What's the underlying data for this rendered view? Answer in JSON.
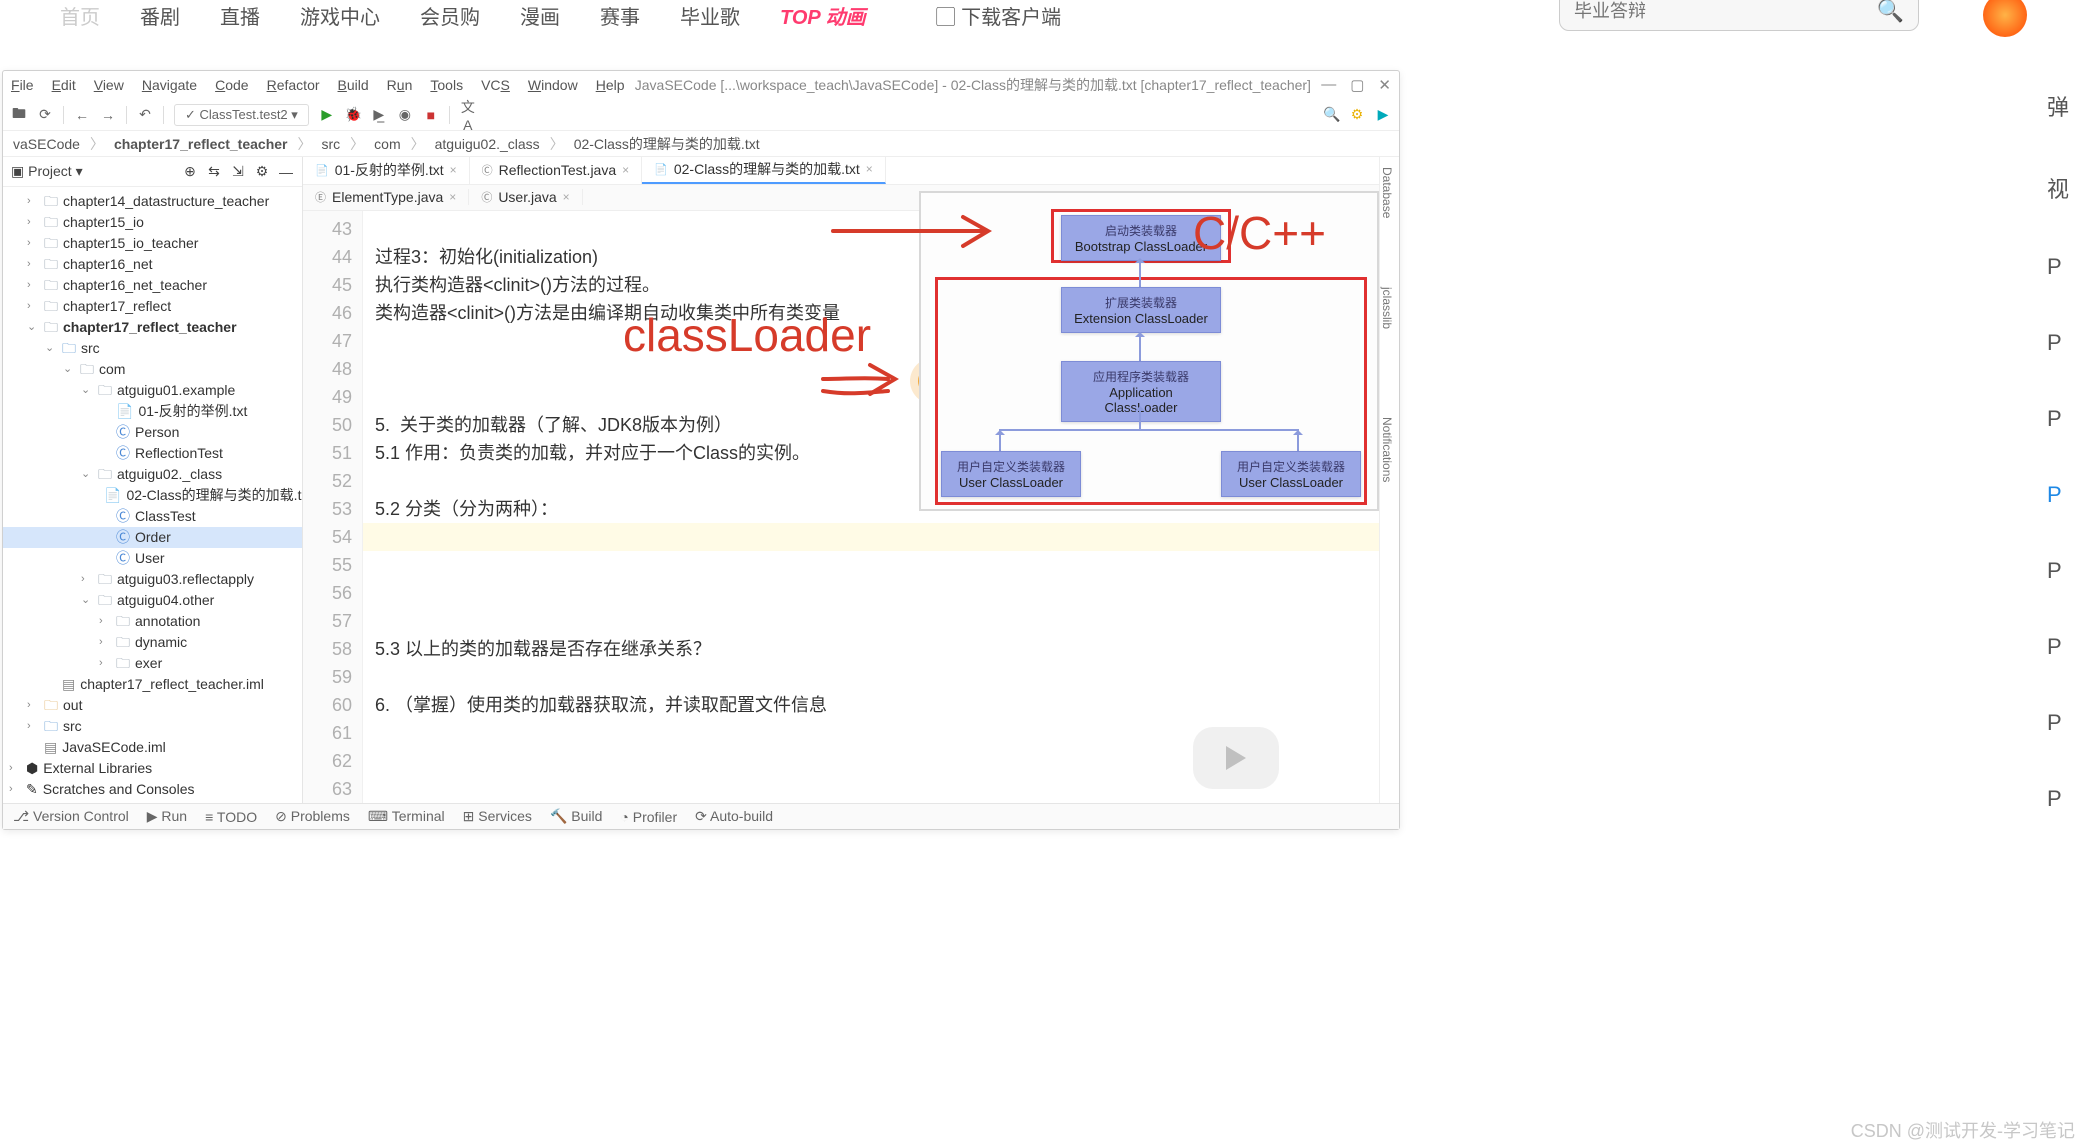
{
  "top_nav": {
    "items": [
      "首页",
      "番剧",
      "直播",
      "游戏中心",
      "会员购",
      "漫画",
      "赛事",
      "毕业歌"
    ],
    "red_item": "TOP 动画",
    "download": "下载客户端",
    "search_placeholder": "毕业答辩"
  },
  "ide": {
    "menu": [
      "File",
      "Edit",
      "View",
      "Navigate",
      "Code",
      "Refactor",
      "Build",
      "Run",
      "Tools",
      "VCS",
      "Window",
      "Help"
    ],
    "window_title": "JavaSECode [...\\workspace_teach\\JavaSECode] - 02-Class的理解与类的加载.txt [chapter17_reflect_teacher]",
    "run_config": "ClassTest.test2",
    "breadcrumb": [
      "vaSECode",
      "chapter17_reflect_teacher",
      "src",
      "com",
      "atguigu02._class",
      "02-Class的理解与类的加载.txt"
    ],
    "project_label": "Project",
    "nav_ind": "3",
    "tree": {
      "items": [
        {
          "indent": 1,
          "arrow": "›",
          "icon": "folder",
          "label": "chapter14_datastructure_teacher"
        },
        {
          "indent": 1,
          "arrow": "›",
          "icon": "folder",
          "label": "chapter15_io"
        },
        {
          "indent": 1,
          "arrow": "›",
          "icon": "folder",
          "label": "chapter15_io_teacher"
        },
        {
          "indent": 1,
          "arrow": "›",
          "icon": "folder",
          "label": "chapter16_net"
        },
        {
          "indent": 1,
          "arrow": "›",
          "icon": "folder",
          "label": "chapter16_net_teacher"
        },
        {
          "indent": 1,
          "arrow": "›",
          "icon": "folder",
          "label": "chapter17_reflect"
        },
        {
          "indent": 1,
          "arrow": "⌄",
          "icon": "folder",
          "label": "chapter17_reflect_teacher",
          "bold": true
        },
        {
          "indent": 2,
          "arrow": "⌄",
          "icon": "folder-blue",
          "label": "src"
        },
        {
          "indent": 3,
          "arrow": "⌄",
          "icon": "folder",
          "label": "com"
        },
        {
          "indent": 4,
          "arrow": "⌄",
          "icon": "folder",
          "label": "atguigu01.example"
        },
        {
          "indent": 5,
          "arrow": "",
          "icon": "txt",
          "label": "01-反射的举例.txt"
        },
        {
          "indent": 5,
          "arrow": "",
          "icon": "class",
          "label": "Person"
        },
        {
          "indent": 5,
          "arrow": "",
          "icon": "class",
          "label": "ReflectionTest"
        },
        {
          "indent": 4,
          "arrow": "⌄",
          "icon": "folder",
          "label": "atguigu02._class"
        },
        {
          "indent": 5,
          "arrow": "",
          "icon": "txt",
          "label": "02-Class的理解与类的加载.t"
        },
        {
          "indent": 5,
          "arrow": "",
          "icon": "class",
          "label": "ClassTest"
        },
        {
          "indent": 5,
          "arrow": "",
          "icon": "class",
          "label": "Order",
          "selected": true
        },
        {
          "indent": 5,
          "arrow": "",
          "icon": "class",
          "label": "User"
        },
        {
          "indent": 4,
          "arrow": "›",
          "icon": "folder",
          "label": "atguigu03.reflectapply"
        },
        {
          "indent": 4,
          "arrow": "⌄",
          "icon": "folder",
          "label": "atguigu04.other"
        },
        {
          "indent": 5,
          "arrow": "›",
          "icon": "folder",
          "label": "annotation"
        },
        {
          "indent": 5,
          "arrow": "›",
          "icon": "folder",
          "label": "dynamic"
        },
        {
          "indent": 5,
          "arrow": "›",
          "icon": "folder",
          "label": "exer"
        },
        {
          "indent": 2,
          "arrow": "",
          "icon": "iml",
          "label": "chapter17_reflect_teacher.iml"
        },
        {
          "indent": 1,
          "arrow": "›",
          "icon": "folder-out",
          "label": "out"
        },
        {
          "indent": 1,
          "arrow": "›",
          "icon": "folder-blue",
          "label": "src"
        },
        {
          "indent": 1,
          "arrow": "",
          "icon": "iml",
          "label": "JavaSECode.iml"
        },
        {
          "indent": 0,
          "arrow": "›",
          "icon": "lib",
          "label": "External Libraries"
        },
        {
          "indent": 0,
          "arrow": "›",
          "icon": "scratch",
          "label": "Scratches and Consoles"
        }
      ]
    },
    "tabs_top": [
      {
        "label": "01-反射的举例.txt",
        "icon": "📄"
      },
      {
        "label": "ReflectionTest.java",
        "icon": "Ⓒ"
      },
      {
        "label": "02-Class的理解与类的加载.txt",
        "icon": "📄",
        "active": true
      }
    ],
    "tabs_sub": [
      {
        "label": "ElementType.java",
        "icon": "Ⓔ"
      },
      {
        "label": "User.java",
        "icon": "Ⓒ"
      }
    ],
    "code_start_line": 43,
    "code_lines": [
      "",
      "过程3：初始化(initialization)",
      "执行类构造器<clinit>()方法的过程。",
      "类构造器<clinit>()方法是由编译期自动收集类中所有类变量",
      "",
      "",
      "",
      "5.  关于类的加载器（了解、JDK8版本为例）",
      "5.1 作用：负责类的加载，并对应于一个Class的实例。",
      "",
      "5.2 分类（分为两种）：",
      "",
      "",
      "",
      "",
      "5.3 以上的类的加载器是否存在继承关系？",
      "",
      "6. （掌握）使用类的加载器获取流，并读取配置文件信息",
      "",
      "",
      ""
    ],
    "status": {
      "items": [
        "Version Control",
        "Run",
        "TODO",
        "Problems",
        "Terminal",
        "Services",
        "Build",
        "Profiler",
        "Auto-build"
      ]
    },
    "rbar": [
      "Database",
      "jclasslib",
      "Notifications"
    ]
  },
  "diagram": {
    "boxes": {
      "bootstrap": {
        "l1": "启动类装载器",
        "l2": "Bootstrap ClassLoader"
      },
      "extension": {
        "l1": "扩展类装载器",
        "l2": "Extension ClassLoader"
      },
      "application": {
        "l1": "应用程序类装载器",
        "l2": "Application ClassLoader"
      },
      "user1": {
        "l1": "用户自定义类装载器",
        "l2": "User ClassLoader"
      },
      "user2": {
        "l1": "用户自定义类装载器",
        "l2": "User ClassLoader"
      }
    }
  },
  "handwriting": {
    "classloader": "classLoader",
    "cpp": "C/C++"
  },
  "right_edge": [
    "弹",
    "视",
    "P",
    "P",
    "P",
    "P",
    "P",
    "P",
    "P",
    "P"
  ],
  "watermark": "CSDN @测试开发-学习笔记"
}
